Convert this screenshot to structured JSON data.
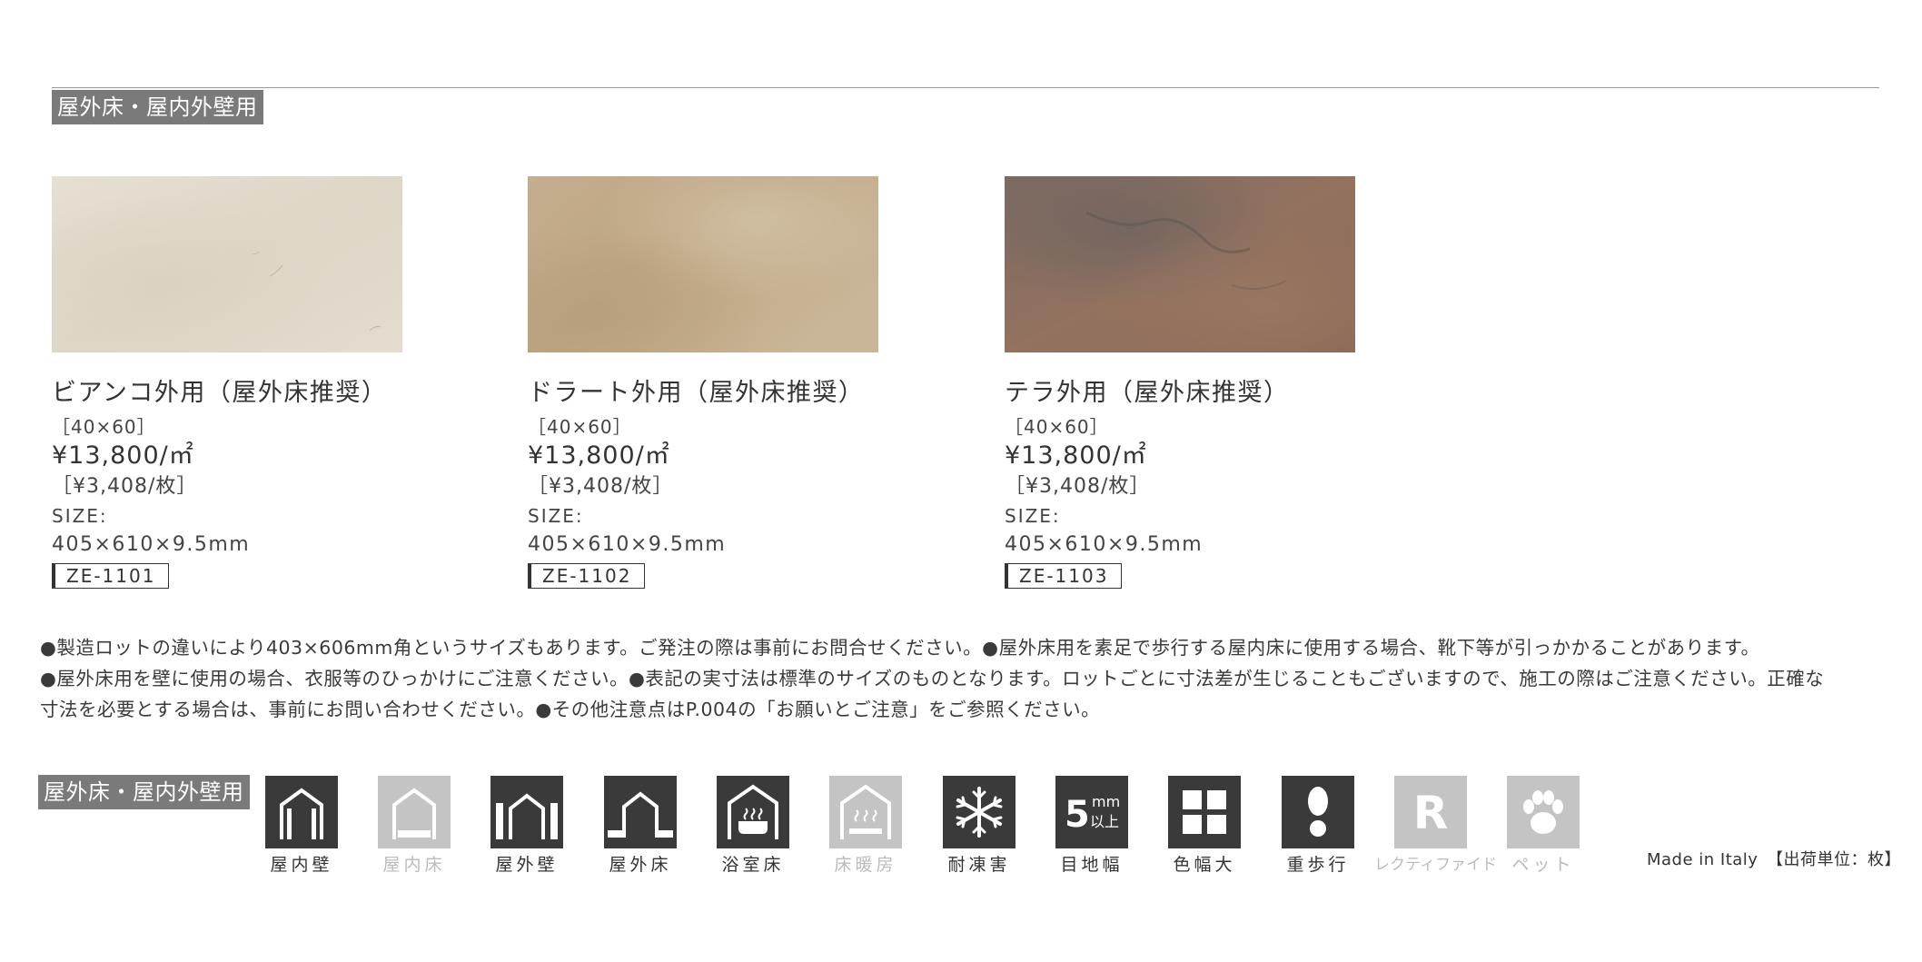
{
  "section_label_top": "屋外床・屋内外壁用",
  "products": [
    {
      "name": "ビアンコ外用（屋外床推奨）",
      "dimension": "［40×60］",
      "price": "¥13,800/㎡",
      "unit_price": "［¥3,408/枚］",
      "size_label": "SIZE:",
      "size": "405×610×9.5mm",
      "code": "ZE-1101",
      "tile_base_color": "#e2dbcd"
    },
    {
      "name": "ドラート外用（屋外床推奨）",
      "dimension": "［40×60］",
      "price": "¥13,800/㎡",
      "unit_price": "［¥3,408/枚］",
      "size_label": "SIZE:",
      "size": "405×610×9.5mm",
      "code": "ZE-1102",
      "tile_base_color": "#bfa888"
    },
    {
      "name": "テラ外用（屋外床推奨）",
      "dimension": "［40×60］",
      "price": "¥13,800/㎡",
      "unit_price": "［¥3,408/枚］",
      "size_label": "SIZE:",
      "size": "405×610×9.5mm",
      "code": "ZE-1103",
      "tile_base_color": "#8a6f62"
    }
  ],
  "notes": [
    "●製造ロットの違いにより403×606mm角というサイズもあります。ご発注の際は事前にお問合せください。●屋外床用を素足で歩行する屋内床に使用する場合、靴下等が引っかかることがあります。",
    "●屋外床用を壁に使用の場合、衣服等のひっかけにご注意ください。●表記の実寸法は標準のサイズのものとなります。ロットごとに寸法差が生じることもございますので、施工の際はご注意ください。正確な",
    "寸法を必要とする場合は、事前にお問い合わせください。●その他注意点はP.004の「お願いとご注意」をご参照ください。"
  ],
  "section_label_bottom": "屋外床・屋内外壁用",
  "icons": [
    {
      "label": "屋内壁",
      "icon": "indoor-wall-icon",
      "active": true
    },
    {
      "label": "屋内床",
      "icon": "indoor-floor-icon",
      "active": false
    },
    {
      "label": "屋外壁",
      "icon": "outdoor-wall-icon",
      "active": true
    },
    {
      "label": "屋外床",
      "icon": "outdoor-floor-icon",
      "active": true
    },
    {
      "label": "浴室床",
      "icon": "bathroom-floor-icon",
      "active": true
    },
    {
      "label": "床暖房",
      "icon": "floor-heating-icon",
      "active": false
    },
    {
      "label": "耐凍害",
      "icon": "snowflake-icon",
      "active": true
    },
    {
      "label": "目地幅",
      "icon": "joint-width-icon",
      "active": true,
      "mark_number": "5",
      "mark_unit": "mm",
      "mark_suffix": "以上"
    },
    {
      "label": "色幅大",
      "icon": "color-variation-icon",
      "active": true
    },
    {
      "label": "重歩行",
      "icon": "footprint-icon",
      "active": true
    },
    {
      "label": "レクティファイド",
      "icon": "rectified-icon",
      "active": false,
      "mark_letter": "R"
    },
    {
      "label": "ペット",
      "icon": "paw-icon",
      "active": false
    }
  ],
  "origin": "Made in Italy　【出荷単位：枚】",
  "colors": {
    "label_bg": "#7a7a7a",
    "icon_active": "#3a3a3a",
    "icon_inactive": "#c4c4c4"
  }
}
